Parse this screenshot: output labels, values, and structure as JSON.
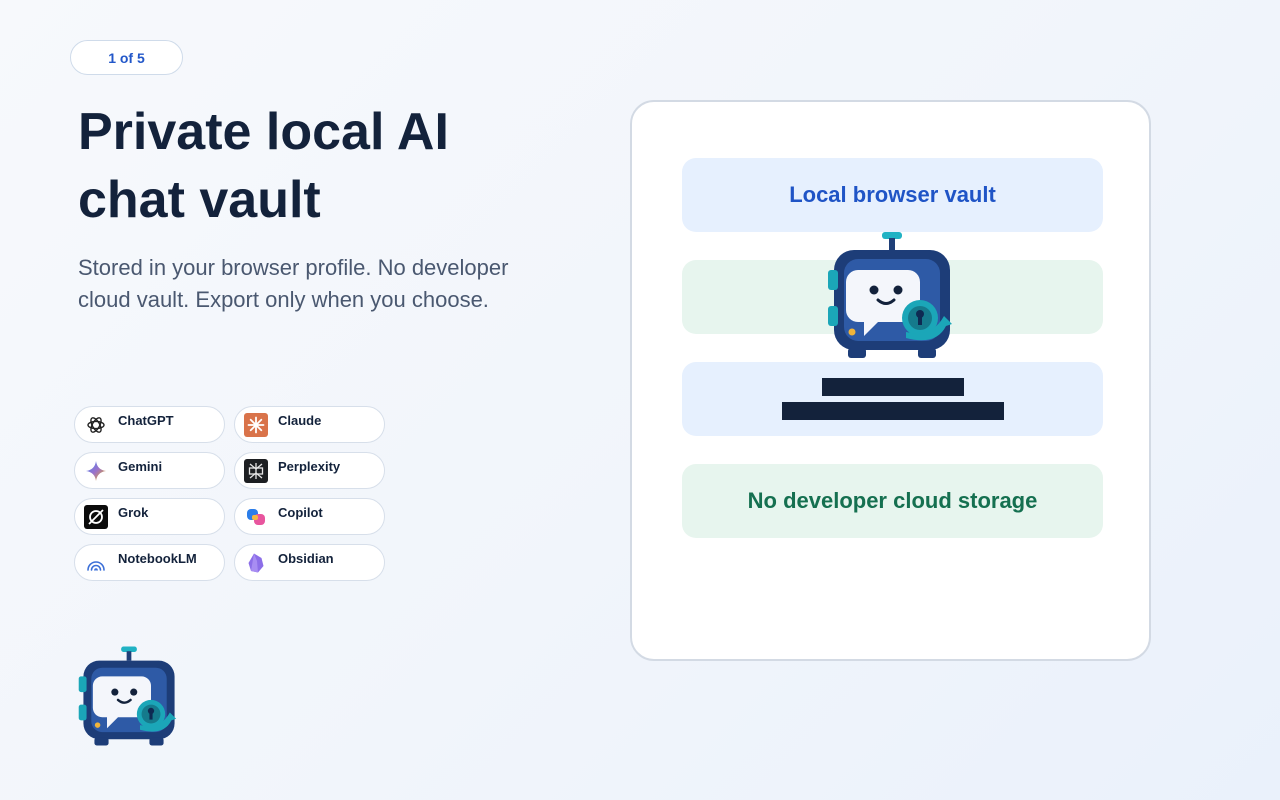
{
  "step": {
    "label": "1 of 5"
  },
  "hero": {
    "title": "Private local AI chat vault",
    "subtitle": "Stored in your browser profile. No developer cloud vault. Export only when you choose."
  },
  "platforms": [
    {
      "label": "ChatGPT",
      "icon": "chatgpt-icon"
    },
    {
      "label": "Claude",
      "icon": "claude-icon"
    },
    {
      "label": "Gemini",
      "icon": "gemini-icon"
    },
    {
      "label": "Perplexity",
      "icon": "perplexity-icon"
    },
    {
      "label": "Grok",
      "icon": "grok-icon"
    },
    {
      "label": "Copilot",
      "icon": "copilot-icon"
    },
    {
      "label": "NotebookLM",
      "icon": "notebooklm-icon"
    },
    {
      "label": "Obsidian",
      "icon": "obsidian-icon"
    }
  ],
  "card": {
    "vault_label": "Local browser vault",
    "storage_label": "No developer cloud storage"
  },
  "colors": {
    "accent_blue": "#1f54c6",
    "accent_green": "#157050",
    "ink": "#13223b",
    "bar_blue_bg": "#e6f0fe",
    "bar_green_bg": "#e7f5ee"
  }
}
